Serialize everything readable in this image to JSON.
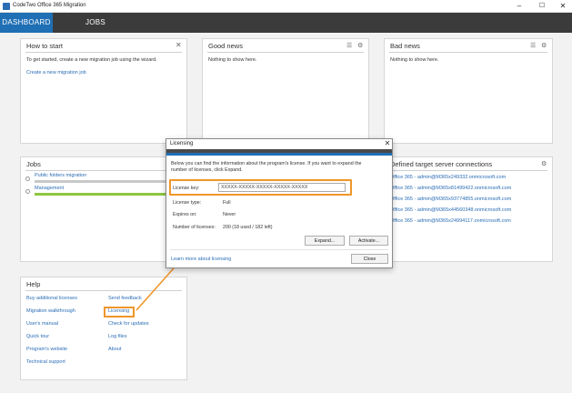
{
  "window": {
    "title": "CodeTwo Office 365 Migration",
    "minimize": "–",
    "maximize": "☐",
    "close": "✕"
  },
  "nav": {
    "tabs": [
      {
        "label": "DASHBOARD",
        "active": true
      },
      {
        "label": "JOBS",
        "active": false
      }
    ]
  },
  "how_to_start": {
    "title": "How to start",
    "close_icon": "✕",
    "text": "To get started, create a new migration job using the wizard.",
    "link": "Create a new migration job"
  },
  "good_news": {
    "title": "Good news",
    "filter_icon": "☰",
    "settings_icon": "⚙",
    "text": "Nothing to show here."
  },
  "bad_news": {
    "title": "Bad news",
    "filter_icon": "☰",
    "settings_icon": "⚙",
    "text": "Nothing to show here."
  },
  "jobs": {
    "title": "Jobs",
    "items": [
      {
        "name": "Public folders migration",
        "progress_color": "#c8c8c8"
      },
      {
        "name": "Management",
        "progress_color": "#8dc63f"
      }
    ]
  },
  "connections": {
    "title": "Defined target server connections",
    "settings_icon": "⚙",
    "items": [
      "Office 365 - admin@M365x249332.onmicrosoft.com",
      "Office 365 - admin@M365x81499422.onmicrosoft.com",
      "Office 365 - admin@M365x93774855.onmicrosoft.com",
      "Office 365 - admin@M365x44560348.onmicrosoft.com",
      "Office 365 - admin@M365x24994117.onmicrosoft.com"
    ]
  },
  "help": {
    "title": "Help",
    "left": [
      "Buy additional licenses",
      "Migration walkthrough",
      "User's manual",
      "Quick tour",
      "Program's website",
      "Technical support"
    ],
    "right": [
      "Send feedback",
      "Licensing",
      "Check for updates",
      "Log files",
      "About"
    ]
  },
  "dialog": {
    "title": "Licensing",
    "close_icon": "✕",
    "intro_line1": "Below you can find the information about the program's license. If you want to expand the",
    "intro_line2": "number of licenses, click Expand.",
    "license_key_label": "License key:",
    "license_key_value": "XXXXX-XXXXX-XXXXX-XXXXX-XXXXX",
    "license_type_label": "License type:",
    "license_type_value": "Full",
    "expires_label": "Expires on:",
    "expires_value": "Never",
    "licenses_label": "Number of licenses:",
    "licenses_value": "200 (18 used / 182 left)",
    "expand_button": "Expand...",
    "activate_button": "Activate...",
    "learn_more_link": "Learn more about licensing",
    "close_button": "Close"
  },
  "colors": {
    "accent": "#1f6fb5",
    "nav_bg": "#3b3b3b",
    "highlight": "#f0962a",
    "link": "#2a6db5"
  }
}
